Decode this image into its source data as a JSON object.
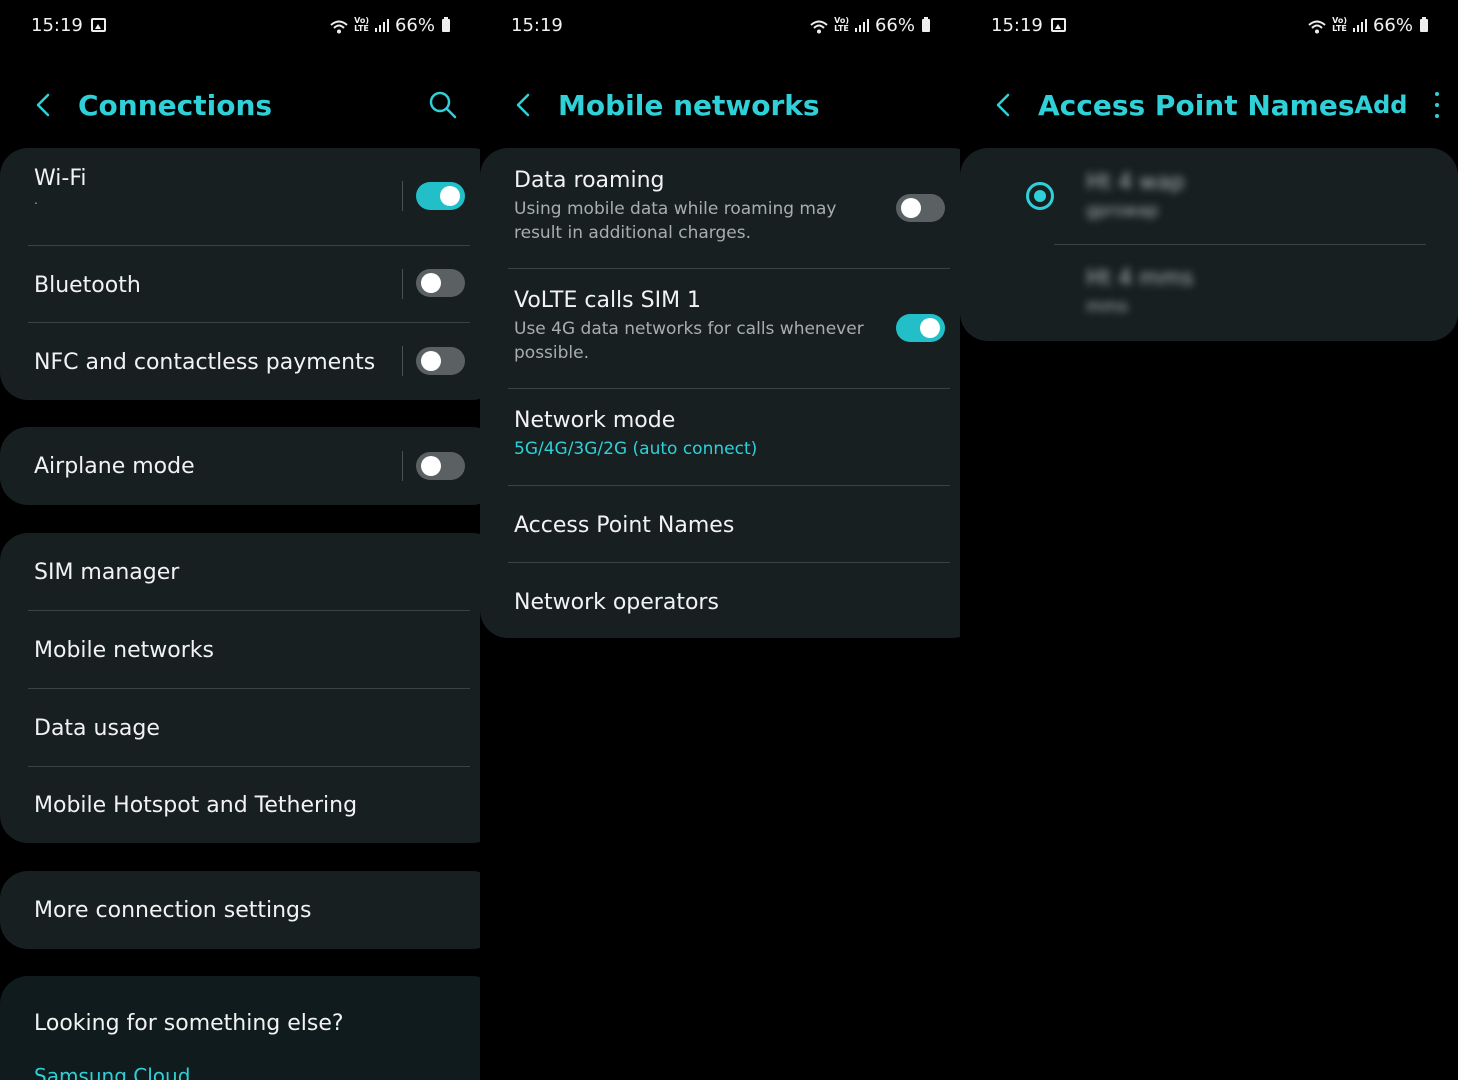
{
  "status": {
    "time": "15:19",
    "battery": "66%",
    "volte_top": "Vo)",
    "volte_bottom": "LTE"
  },
  "screen1": {
    "title": "Connections",
    "items": {
      "wifi": {
        "label": "Wi-Fi",
        "sub": ".",
        "on": true
      },
      "bluetooth": {
        "label": "Bluetooth",
        "on": false
      },
      "nfc": {
        "label": "NFC and contactless payments",
        "on": false
      },
      "airplane": {
        "label": "Airplane mode",
        "on": false
      },
      "sim": {
        "label": "SIM manager"
      },
      "mobile": {
        "label": "Mobile networks"
      },
      "data": {
        "label": "Data usage"
      },
      "hotspot": {
        "label": "Mobile Hotspot and Tethering"
      },
      "more": {
        "label": "More connection settings"
      }
    },
    "looking": {
      "heading": "Looking for something else?",
      "link": "Samsung Cloud"
    }
  },
  "screen2": {
    "title": "Mobile networks",
    "items": {
      "roaming": {
        "label": "Data roaming",
        "sub": "Using mobile data while roaming may result in additional charges.",
        "on": false
      },
      "volte": {
        "label": "VoLTE calls SIM 1",
        "sub": "Use 4G data networks for calls whenever possible.",
        "on": true
      },
      "mode": {
        "label": "Network mode",
        "sub": "5G/4G/3G/2G (auto connect)"
      },
      "apn": {
        "label": "Access Point Names"
      },
      "operators": {
        "label": "Network operators"
      }
    }
  },
  "screen3": {
    "title": "Access Point Names",
    "add_label": "Add",
    "apns": [
      {
        "name": "Ht 4 wap",
        "detail": "gprswap",
        "selected": true
      },
      {
        "name": "Ht 4 mms",
        "detail": "mms",
        "selected": false
      }
    ]
  },
  "colors": {
    "accent": "#2fd0d8",
    "card": "#171f21",
    "toggle_on": "#22bfc8",
    "toggle_off": "#5b6163"
  }
}
